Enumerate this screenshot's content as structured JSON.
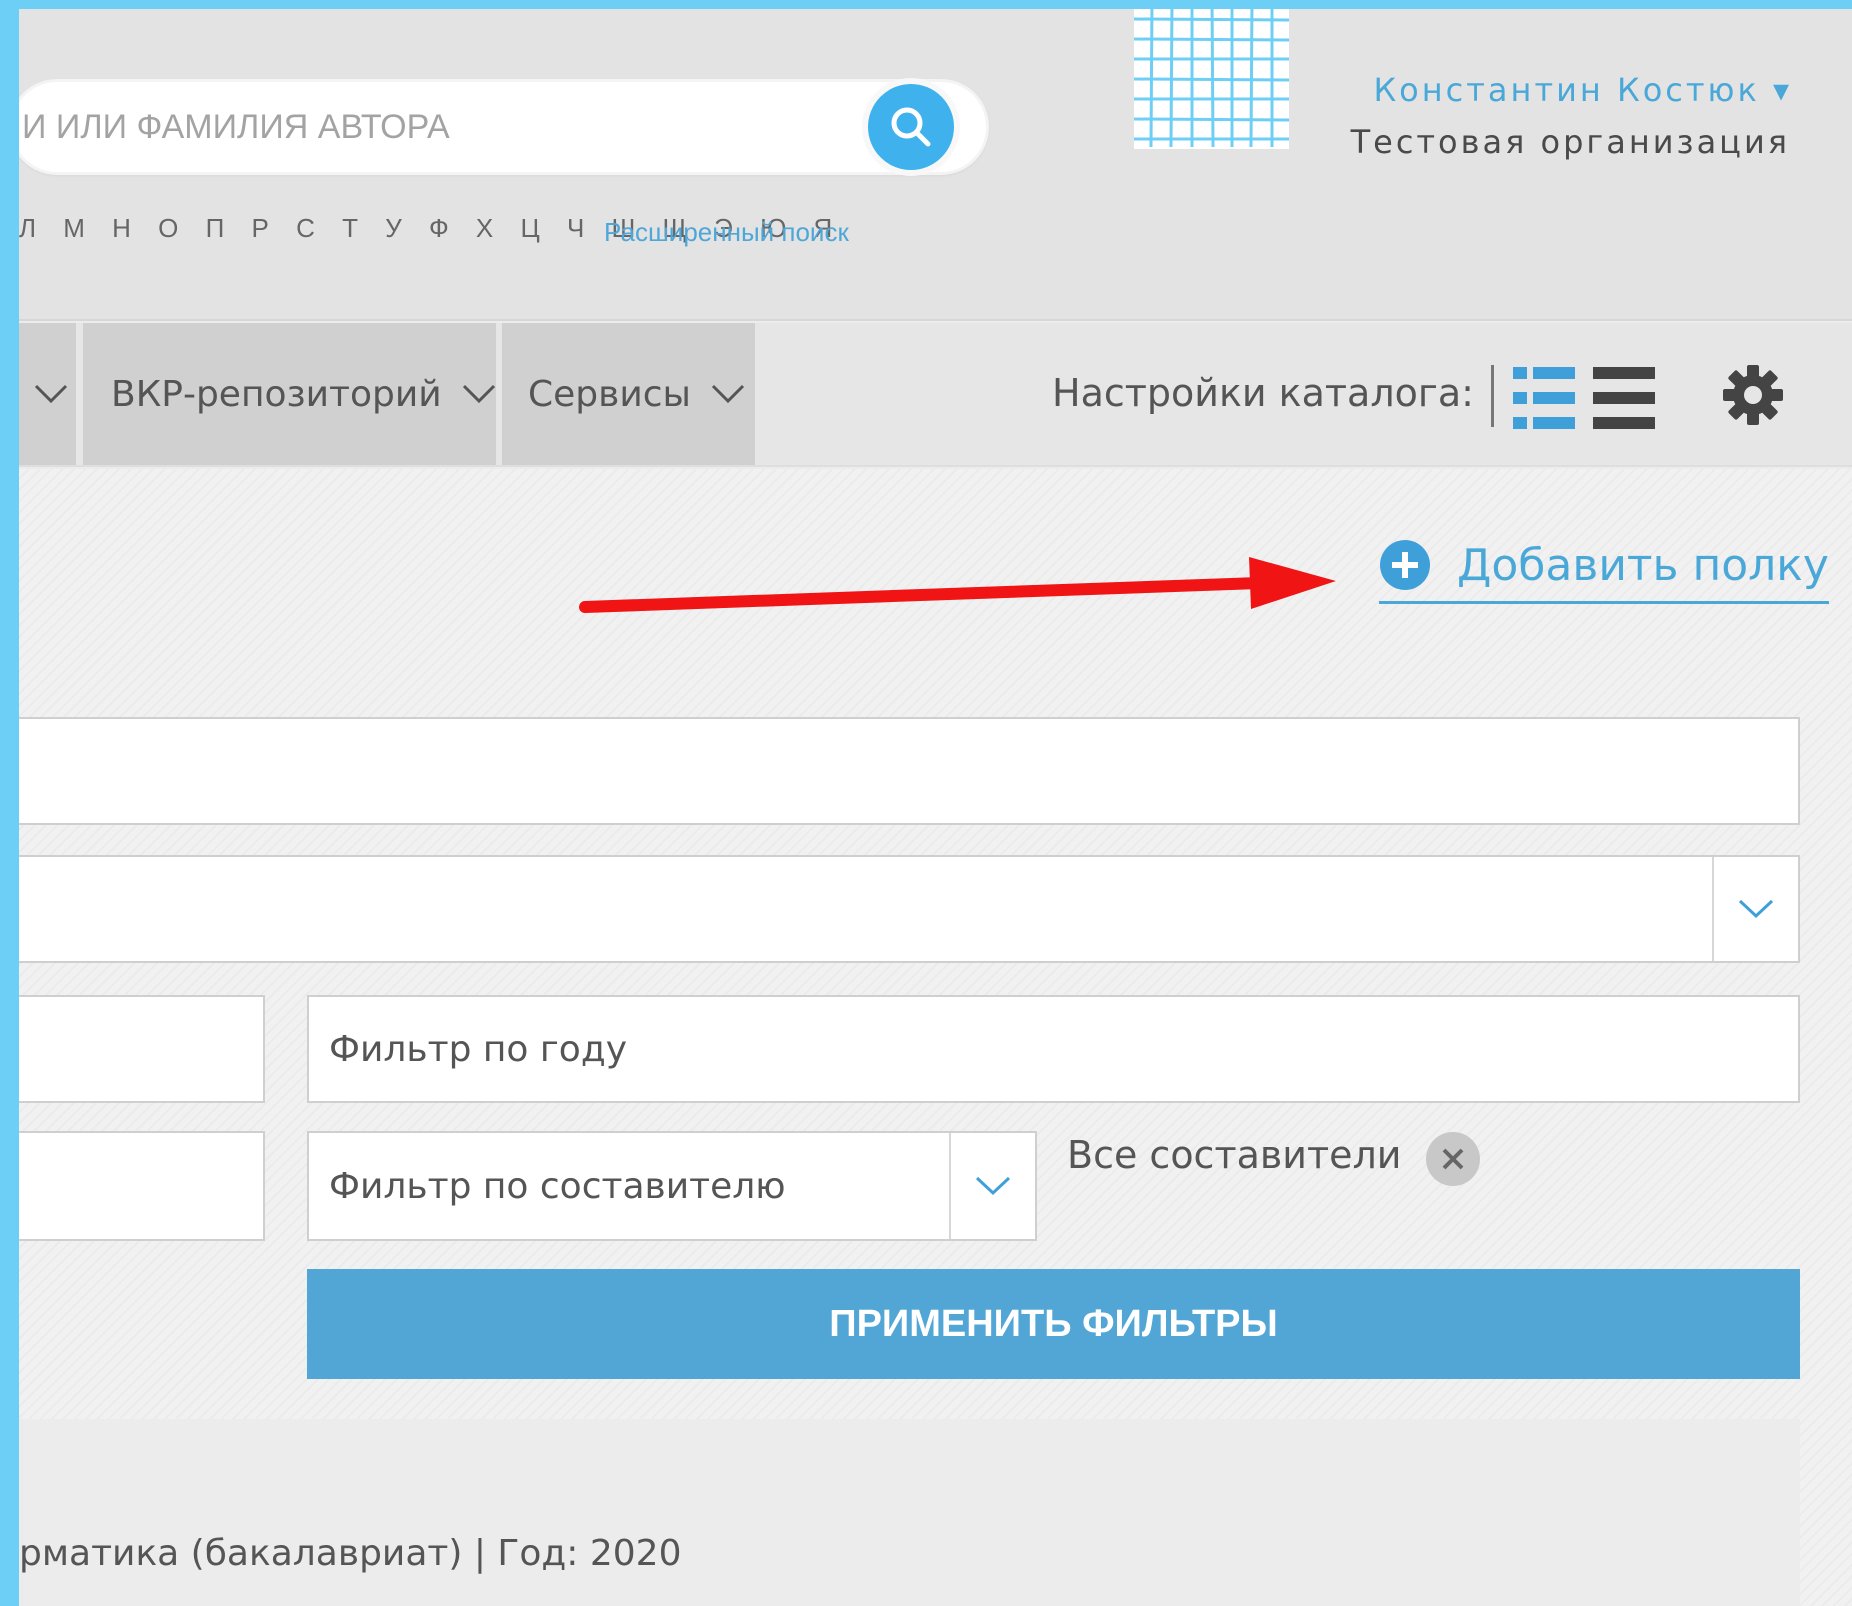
{
  "header": {
    "search": {
      "placeholder": "и или фамилия автора"
    },
    "alphabet": "Л М Н О П Р С Т У Ф Х Ц Ч Ш Щ Э Ю Я",
    "advanced_search_label": "Расширенный поиск",
    "user": {
      "name": "Константин Костюк ▾",
      "organization": "Тестовая организация"
    }
  },
  "nav": {
    "items": [
      {
        "label": ""
      },
      {
        "label": "ВКР-репозиторий"
      },
      {
        "label": "Сервисы"
      }
    ],
    "catalog_settings_label": "Настройки каталога:"
  },
  "content": {
    "add_shelf_label": "Добавить полку",
    "year_filter_placeholder": "Фильтр по году",
    "compiler_filter_placeholder": "Фильтр по составителю",
    "compilers_chip_label": "Все составители",
    "apply_button_label": "ПРИМЕНИТЬ ФИЛЬТРЫ",
    "result_meta": "рматика (бакалавриат) |  Год: 2020"
  },
  "colors": {
    "accent": "#4aa8d8",
    "button": "#51a6d6",
    "search_button": "#3fb1ec",
    "annotation_arrow": "#f01414"
  }
}
